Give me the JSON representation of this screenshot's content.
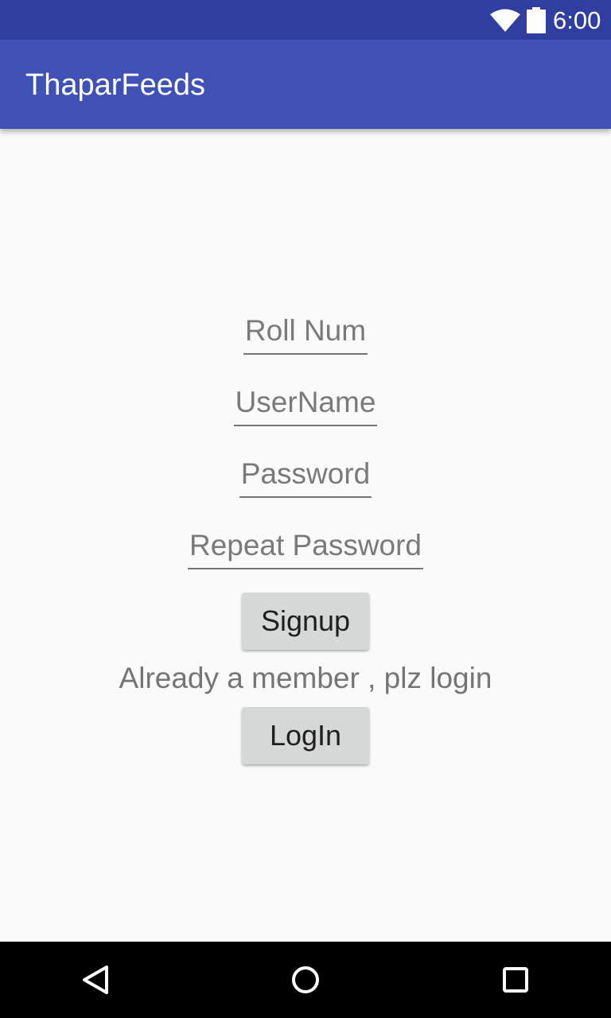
{
  "status_bar": {
    "time": "6:00",
    "icons": [
      "wifi-icon",
      "battery-icon"
    ]
  },
  "app_bar": {
    "title": "ThaparFeeds"
  },
  "form": {
    "roll_num_placeholder": "Roll Num",
    "username_placeholder": "UserName",
    "password_placeholder": "Password",
    "repeat_password_placeholder": "Repeat Password",
    "signup_label": "Signup",
    "member_text": "Already a member , plz login",
    "login_label": "LogIn"
  },
  "nav_bar": {
    "icons": [
      "back-icon",
      "home-icon",
      "recents-icon"
    ]
  },
  "colors": {
    "status_bar": "#303f9f",
    "app_bar": "#3f51b5",
    "background": "#fafafa",
    "button": "#d6d7d7",
    "nav_bar": "#000000"
  }
}
